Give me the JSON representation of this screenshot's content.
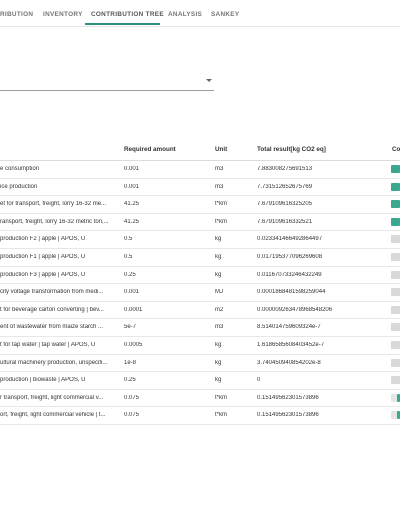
{
  "tabs": [
    {
      "label": "RIBUTION"
    },
    {
      "label": "INVENTORY"
    },
    {
      "label": "CONTRIBUTION TREE"
    },
    {
      "label": "ANALYSIS"
    },
    {
      "label": "SANKEY"
    }
  ],
  "active_tab": "CONTRIBUTION TREE",
  "accent_color": "#2f8f7f",
  "bar_color": "#3aa88e",
  "table": {
    "headers": {
      "name": "",
      "amount": "Required amount",
      "unit": "Unit",
      "result": "Total result[kg CO2 eq]",
      "contribution": "Co"
    },
    "rows": [
      {
        "name": "e consumption",
        "amount": "0.001",
        "unit": "m3",
        "result": "7.883008275691513",
        "bar": "green",
        "share": 1.0
      },
      {
        "name": "ice production",
        "amount": "0.001",
        "unit": "m3",
        "result": "7.73151265267576​9",
        "bar": "green",
        "share": 0.98
      },
      {
        "name": "et for transport, freight, lorry 16-32 me...",
        "amount": "41.25",
        "unit": "t*km",
        "result": "7.679109616325205",
        "bar": "green",
        "share": 0.97
      },
      {
        "name": "ransport, freight, lorry 16-32 metric ton,...",
        "amount": "41.25",
        "unit": "t*km",
        "result": "7.679109616332521",
        "bar": "green",
        "share": 0.97
      },
      {
        "name": "production F2 | apple | APOS, U",
        "amount": "0.5",
        "unit": "kg",
        "result": "0.023341466492864497",
        "bar": "gray",
        "share": 0.003
      },
      {
        "name": "production F1 | apple | APOS, U",
        "amount": "0.5",
        "unit": "kg",
        "result": "0.017195377096269608",
        "bar": "gray",
        "share": 0.002
      },
      {
        "name": "production F3 | apple | APOS, U",
        "amount": "0.25",
        "unit": "kg",
        "result": "0.011670733246432249",
        "bar": "gray",
        "share": 0.0015
      },
      {
        "name": "city voltage transformation from medi...",
        "amount": "0.001",
        "unit": "MJ",
        "result": "0.000186848159825904​4",
        "bar": "gray",
        "share": 0.0
      },
      {
        "name": "t for beverage carton converting | bev...",
        "amount": "0.0001",
        "unit": "m2",
        "result": "0.00000926347896854820​6",
        "bar": "gray",
        "share": 0.0
      },
      {
        "name": "ent of wastewater from maize starch ...",
        "amount": "5e-7",
        "unit": "m3",
        "result": "8.514014759609324e-7",
        "bar": "gray",
        "share": 0.0
      },
      {
        "name": "t for tap water | tap water | APOS, U",
        "amount": "0.0005",
        "unit": "kg",
        "result": "1.6186585608403452e-7",
        "bar": "gray",
        "share": 0.0
      },
      {
        "name": "ultural machinery production, unspecifi...",
        "amount": "1e-8",
        "unit": "kg",
        "result": "3.740450940854202e-8",
        "bar": "gray",
        "share": 0.0
      },
      {
        "name": "production | biowaste | APOS, U",
        "amount": "0.25",
        "unit": "kg",
        "result": "0",
        "bar": "gray",
        "share": 0.0
      },
      {
        "name": "r transport, freight, light commercial v...",
        "amount": "0.075",
        "unit": "t*km",
        "result": "0.15149562301573896",
        "bar": "thin",
        "share": 0.02
      },
      {
        "name": "ort, freight, light commercial vehicle | t...",
        "amount": "0.075",
        "unit": "t*km",
        "result": "0.15149562301573896",
        "bar": "thin",
        "share": 0.02
      }
    ]
  }
}
